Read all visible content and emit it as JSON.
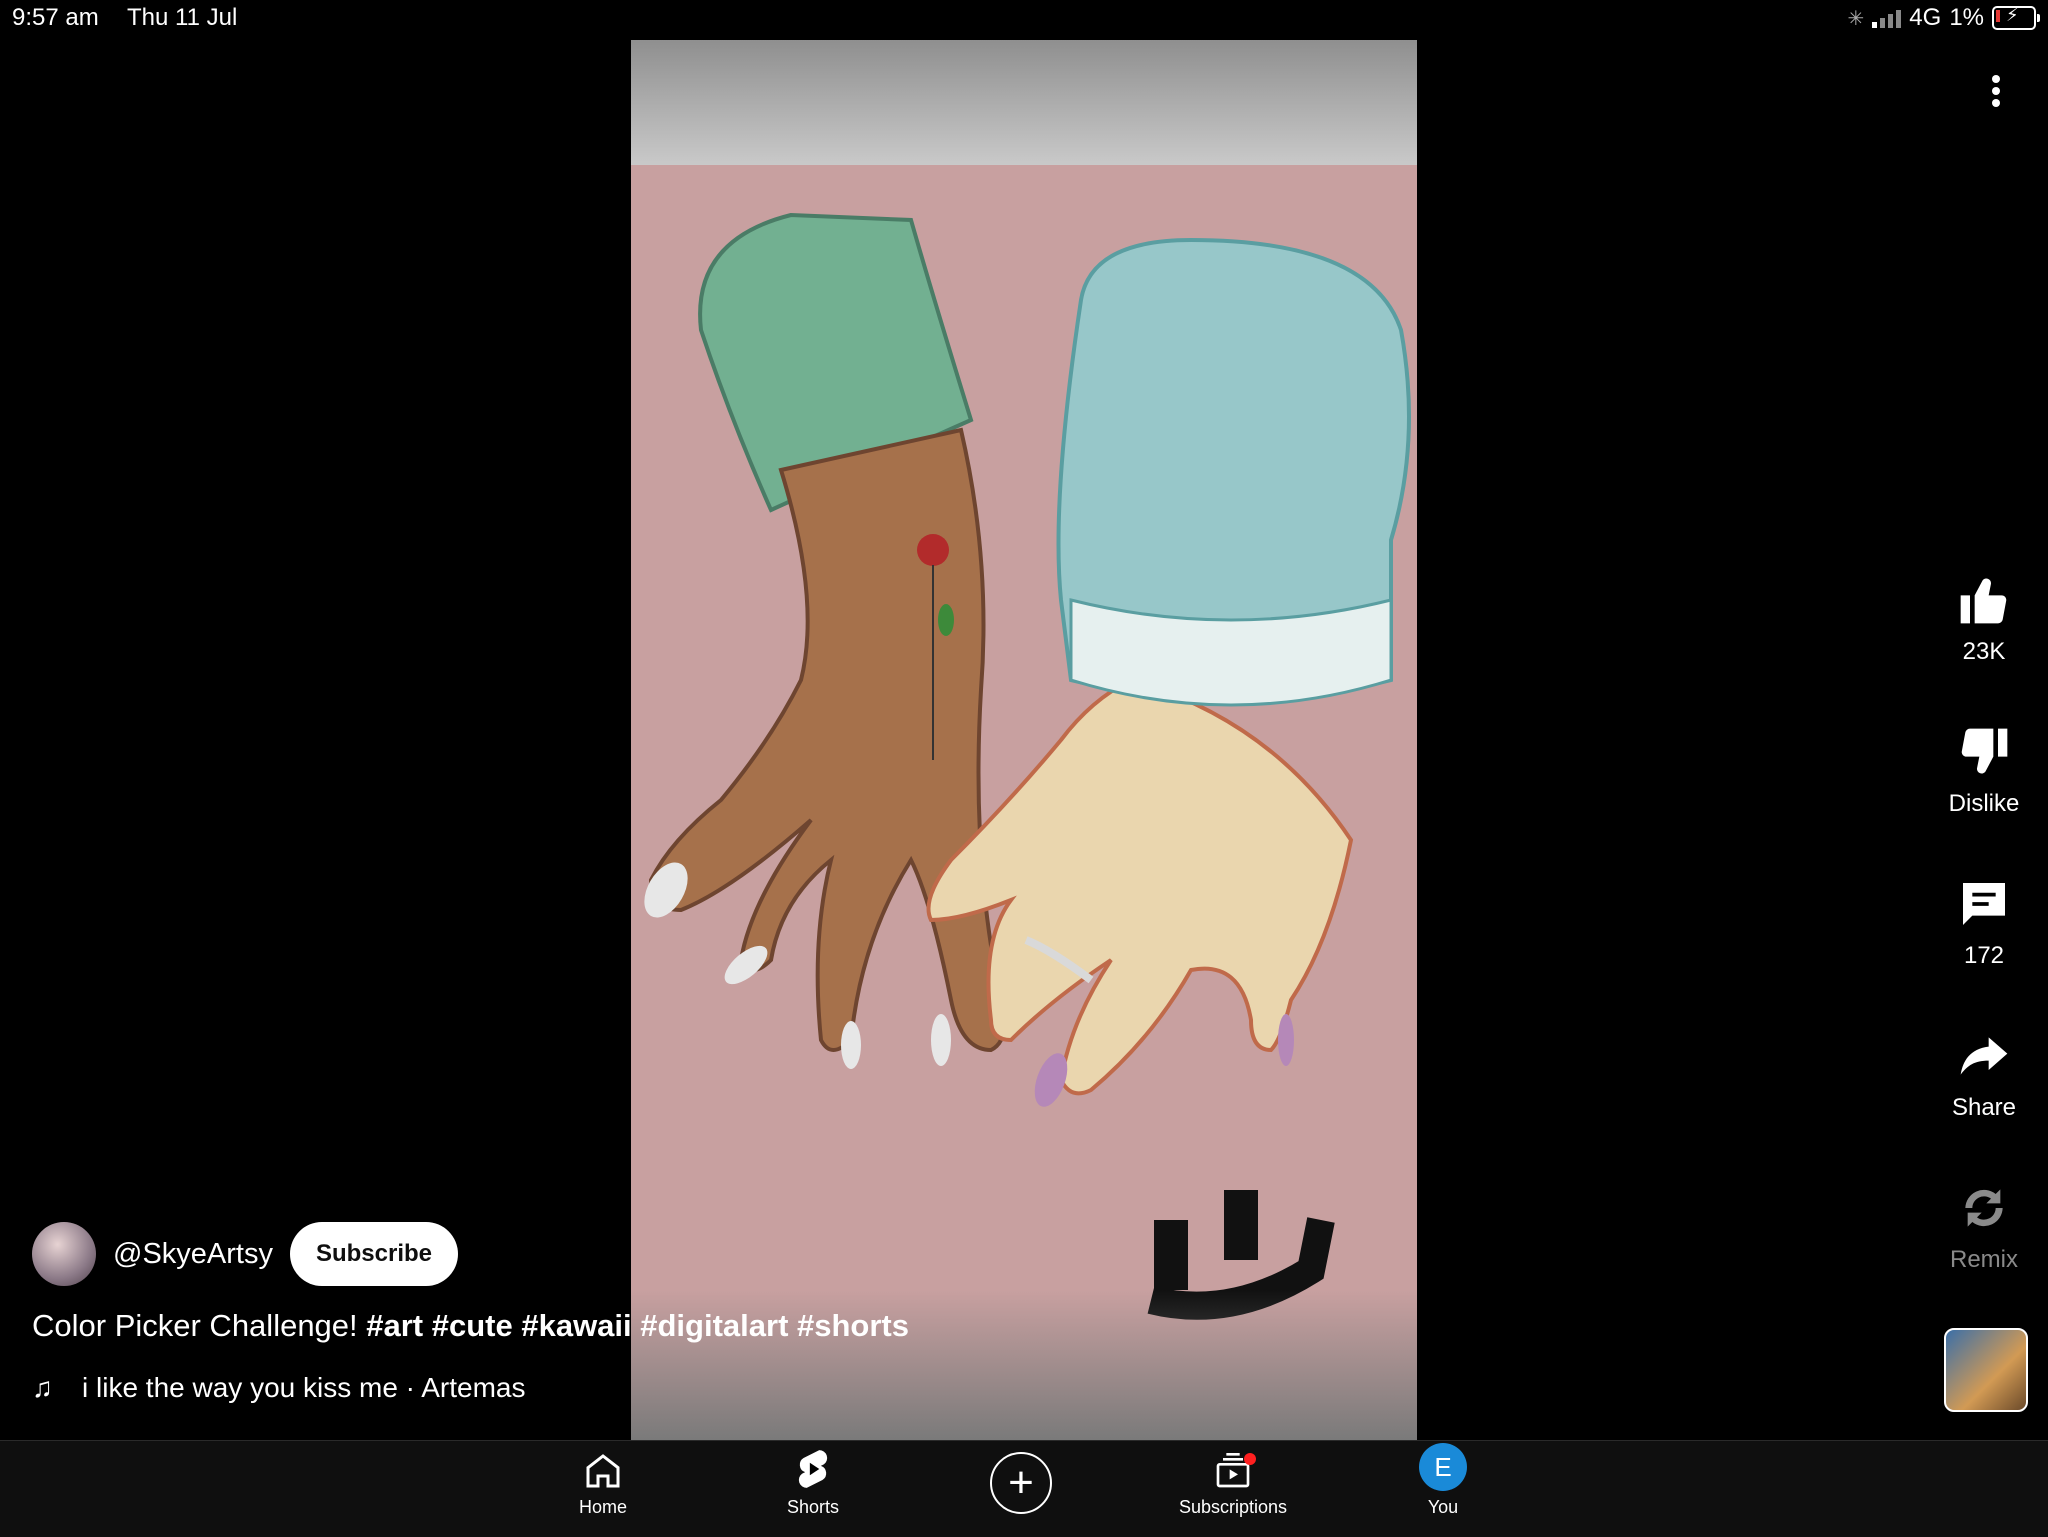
{
  "status": {
    "time": "9:57 am",
    "date": "Thu 11 Jul",
    "network": "4G",
    "battery": "1%",
    "battery_level": 0.01,
    "icons": [
      "loading-spinner-icon",
      "signal-bars-icon",
      "battery-charging-icon"
    ]
  },
  "actions": {
    "like_count": "23K",
    "dislike_label": "Dislike",
    "comment_count": "172",
    "share_label": "Share",
    "remix_label": "Remix"
  },
  "video": {
    "channel_handle": "@SkyeArtsy",
    "subscribe_label": "Subscribe",
    "title_plain": "Color Picker Challenge! ",
    "title_hashtags": "#art #cute #kawaii #digitalart #shorts",
    "music": "i like the way you kiss me · Artemas"
  },
  "nav": {
    "home": "Home",
    "shorts": "Shorts",
    "subscriptions": "Subscriptions",
    "you": "You",
    "you_initial": "E"
  }
}
